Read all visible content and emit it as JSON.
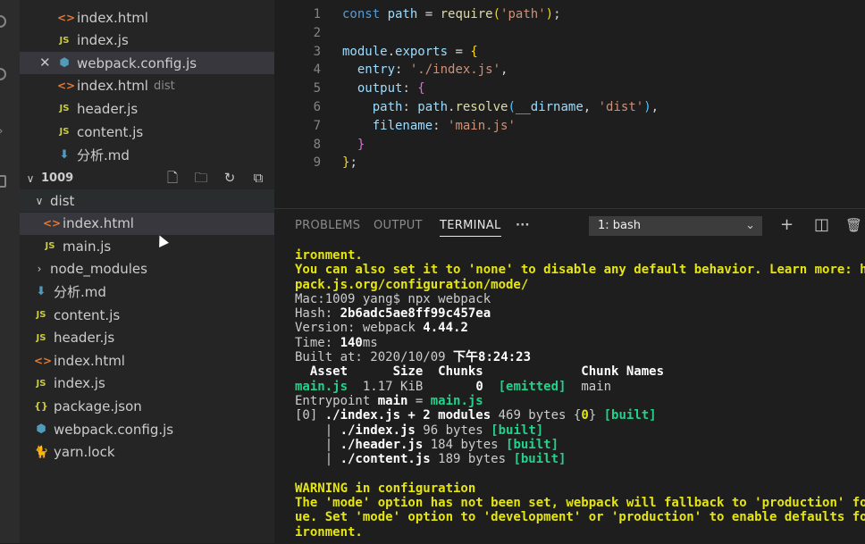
{
  "explorer": {
    "open_editors": [
      {
        "icon": "html-file-icon",
        "glyph": "<>",
        "name": "index.html",
        "desc": ""
      },
      {
        "icon": "js-file-icon",
        "glyph": "JS",
        "name": "index.js",
        "desc": ""
      },
      {
        "icon": "webpack-file-icon",
        "glyph": "⬢",
        "name": "webpack.config.js",
        "desc": "",
        "close": "✕",
        "selected": true
      },
      {
        "icon": "html-file-icon",
        "glyph": "<>",
        "name": "index.html",
        "desc": "dist"
      },
      {
        "icon": "js-file-icon",
        "glyph": "JS",
        "name": "header.js",
        "desc": ""
      },
      {
        "icon": "js-file-icon",
        "glyph": "JS",
        "name": "content.js",
        "desc": ""
      },
      {
        "icon": "markdown-file-icon",
        "glyph": "⬇",
        "name": "分析.md",
        "desc": ""
      }
    ],
    "folder": {
      "chevron": "∨",
      "name": "1009",
      "toolbar": [
        "new-file-icon",
        "new-folder-icon",
        "refresh-icon",
        "collapse-all-icon"
      ]
    },
    "tree": [
      {
        "depth": 1,
        "type": "folder-open",
        "name": "dist"
      },
      {
        "depth": 2,
        "type": "html",
        "glyph": "<>",
        "name": "index.html"
      },
      {
        "depth": 2,
        "type": "js",
        "glyph": "JS",
        "name": "main.js"
      },
      {
        "depth": 1,
        "type": "folder",
        "name": "node_modules"
      },
      {
        "depth": 1,
        "type": "md",
        "glyph": "⬇",
        "name": "分析.md"
      },
      {
        "depth": 1,
        "type": "js",
        "glyph": "JS",
        "name": "content.js"
      },
      {
        "depth": 1,
        "type": "js",
        "glyph": "JS",
        "name": "header.js"
      },
      {
        "depth": 1,
        "type": "html",
        "glyph": "<>",
        "name": "index.html"
      },
      {
        "depth": 1,
        "type": "js",
        "glyph": "JS",
        "name": "index.js"
      },
      {
        "depth": 1,
        "type": "json",
        "glyph": "{}",
        "name": "package.json"
      },
      {
        "depth": 1,
        "type": "wp",
        "glyph": "⬢",
        "name": "webpack.config.js"
      },
      {
        "depth": 1,
        "type": "yarn",
        "glyph": "🐈",
        "name": "yarn.lock"
      }
    ]
  },
  "editor": {
    "lines": [
      {
        "n": "1",
        "tokens": [
          [
            "k",
            "const "
          ],
          [
            "v",
            "path"
          ],
          [
            "p",
            " = "
          ],
          [
            "f",
            "require"
          ],
          [
            "y",
            "("
          ],
          [
            "s",
            "'path'"
          ],
          [
            "y",
            ")"
          ],
          [
            "p",
            ";"
          ]
        ]
      },
      {
        "n": "2",
        "tokens": []
      },
      {
        "n": "3",
        "tokens": [
          [
            "v",
            "module"
          ],
          [
            "p",
            "."
          ],
          [
            "v",
            "exports"
          ],
          [
            "p",
            " = "
          ],
          [
            "y",
            "{"
          ]
        ]
      },
      {
        "n": "4",
        "tokens": [
          [
            "p",
            "  "
          ],
          [
            "v",
            "entry"
          ],
          [
            "p",
            ": "
          ],
          [
            "s",
            "'./index.js'"
          ],
          [
            "p",
            ","
          ]
        ]
      },
      {
        "n": "5",
        "tokens": [
          [
            "p",
            "  "
          ],
          [
            "v",
            "output"
          ],
          [
            "p",
            ": "
          ],
          [
            "b",
            "{"
          ]
        ]
      },
      {
        "n": "6",
        "tokens": [
          [
            "p",
            "    "
          ],
          [
            "v",
            "path"
          ],
          [
            "p",
            ": "
          ],
          [
            "v",
            "path"
          ],
          [
            "p",
            "."
          ],
          [
            "f",
            "resolve"
          ],
          [
            "c",
            "("
          ],
          [
            "v",
            "__dirname"
          ],
          [
            "p",
            ", "
          ],
          [
            "s",
            "'dist'"
          ],
          [
            "c",
            ")"
          ],
          [
            "p",
            ","
          ]
        ]
      },
      {
        "n": "7",
        "tokens": [
          [
            "p",
            "    "
          ],
          [
            "v",
            "filename"
          ],
          [
            "p",
            ": "
          ],
          [
            "s",
            "'main.js'"
          ]
        ]
      },
      {
        "n": "8",
        "tokens": [
          [
            "p",
            "  "
          ],
          [
            "b",
            "}"
          ]
        ]
      },
      {
        "n": "9",
        "tokens": [
          [
            "y",
            "}"
          ],
          [
            "p",
            ";"
          ]
        ]
      }
    ]
  },
  "panel": {
    "tabs": [
      "PROBLEMS",
      "OUTPUT",
      "TERMINAL",
      "···"
    ],
    "active_tab": "TERMINAL",
    "shell": "1: bash",
    "shell_chevron": "⌄",
    "actions": {
      "add": "+",
      "split": "◫",
      "trash": "🗑"
    }
  },
  "terminal": [
    [
      [
        "yb",
        "ironment."
      ]
    ],
    [
      [
        "yb",
        "You can also set it to 'none' to disable any default behavior. Learn more: htt"
      ]
    ],
    [
      [
        "yb",
        "pack.js.org/configuration/mode/"
      ]
    ],
    [
      [
        "n",
        "Mac:1009 yang$ npx webpack"
      ]
    ],
    [
      [
        "n",
        "Hash: "
      ],
      [
        "wb",
        "2b6adc5ae8ff99c457ea"
      ]
    ],
    [
      [
        "n",
        "Version: webpack "
      ],
      [
        "wb",
        "4.44.2"
      ]
    ],
    [
      [
        "n",
        "Time: "
      ],
      [
        "wb",
        "140"
      ],
      [
        "n",
        "ms"
      ]
    ],
    [
      [
        "n",
        "Built at: 2020/10/09 "
      ],
      [
        "wb",
        "下午8:24:23"
      ]
    ],
    [
      [
        "wb",
        "  Asset      Size  Chunks             Chunk Names"
      ]
    ],
    [
      [
        "gb",
        "main.js"
      ],
      [
        "n",
        "  1.17 KiB       "
      ],
      [
        "wb",
        "0"
      ],
      [
        "n",
        "  "
      ],
      [
        "gb",
        "[emitted]"
      ],
      [
        "n",
        "  main"
      ]
    ],
    [
      [
        "n",
        "Entrypoint "
      ],
      [
        "wb",
        "main"
      ],
      [
        "n",
        " = "
      ],
      [
        "gb",
        "main.js"
      ]
    ],
    [
      [
        "n",
        "[0] "
      ],
      [
        "wb",
        "./index.js + 2 modules"
      ],
      [
        "n",
        " 469 bytes {"
      ],
      [
        "yb",
        "0"
      ],
      [
        "n",
        "} "
      ],
      [
        "gb",
        "[built]"
      ]
    ],
    [
      [
        "n",
        "    | "
      ],
      [
        "wb",
        "./index.js"
      ],
      [
        "n",
        " 96 bytes "
      ],
      [
        "gb",
        "[built]"
      ]
    ],
    [
      [
        "n",
        "    | "
      ],
      [
        "wb",
        "./header.js"
      ],
      [
        "n",
        " 184 bytes "
      ],
      [
        "gb",
        "[built]"
      ]
    ],
    [
      [
        "n",
        "    | "
      ],
      [
        "wb",
        "./content.js"
      ],
      [
        "n",
        " 189 bytes "
      ],
      [
        "gb",
        "[built]"
      ]
    ],
    [
      [
        "n",
        ""
      ]
    ],
    [
      [
        "yb",
        "WARNING in configuration"
      ]
    ],
    [
      [
        "yb",
        "The 'mode' option has not been set, webpack will fallback to 'production' for"
      ]
    ],
    [
      [
        "yb",
        "ue. Set 'mode' option to 'development' or 'production' to enable defaults for"
      ]
    ],
    [
      [
        "yb",
        "ironment."
      ]
    ]
  ]
}
